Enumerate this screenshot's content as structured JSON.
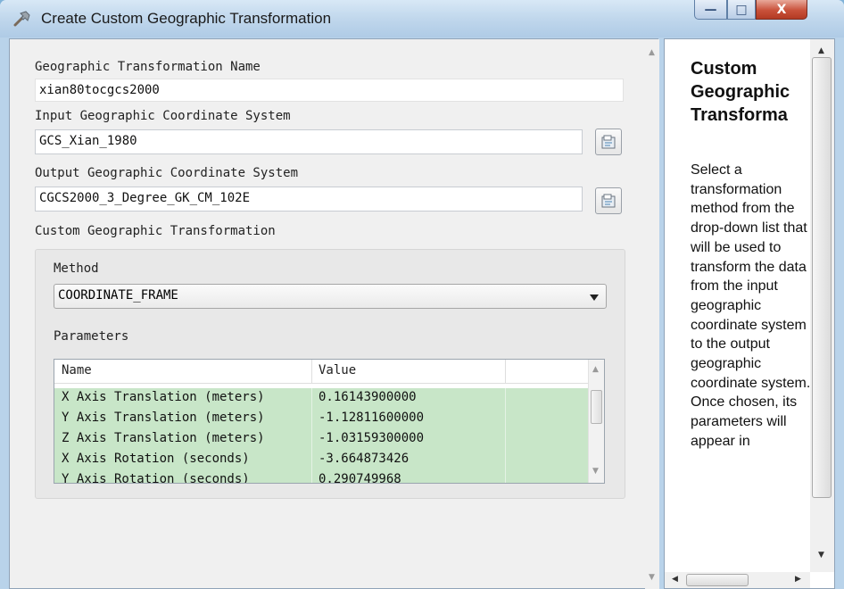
{
  "window": {
    "title": "Create Custom Geographic Transformation"
  },
  "controls": {
    "minimize": "—",
    "maximize": "□",
    "close": "X"
  },
  "form": {
    "name_label": "Geographic Transformation Name",
    "name_value": "xian80tocgcs2000",
    "input_label": "Input Geographic Coordinate System",
    "input_value": "GCS_Xian_1980",
    "output_label": "Output Geographic Coordinate System",
    "output_value": "CGCS2000_3_Degree_GK_CM_102E",
    "custom_label": "Custom Geographic Transformation",
    "method_label": "Method",
    "method_value": "COORDINATE_FRAME",
    "parameters_label": "Parameters",
    "columns": [
      "Name",
      "Value"
    ],
    "rows": [
      {
        "name": "X Axis Translation (meters)",
        "value": "0.16143900000"
      },
      {
        "name": "Y Axis Translation (meters)",
        "value": "-1.12811600000"
      },
      {
        "name": "Z Axis Translation (meters)",
        "value": "-1.03159300000"
      },
      {
        "name": "X Axis Rotation (seconds)",
        "value": "-3.664873426"
      },
      {
        "name": "Y Axis Rotation (seconds)",
        "value": "0.290749968"
      }
    ]
  },
  "help": {
    "title": "Custom Geographic Transforma",
    "body": "Select a transformation method from the drop-down list that will be used to transform the data from the input geographic coordinate system to the output geographic coordinate system. Once chosen, its parameters will appear in"
  },
  "colors": {
    "row_highlight": "#c8e6c8",
    "titlebar": "#c0d7ec",
    "close_button": "#c9513a"
  },
  "icons": [
    "hammer-icon",
    "browse-folder-icon",
    "dropdown-arrow-icon",
    "scroll-arrow-icon"
  ]
}
